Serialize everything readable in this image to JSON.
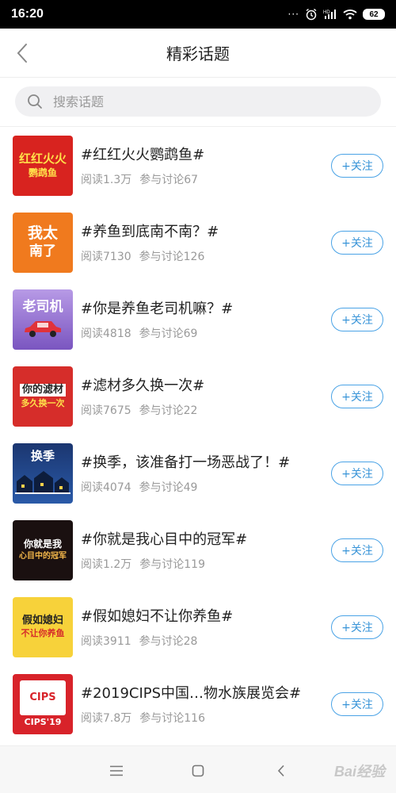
{
  "status_bar": {
    "time": "16:20",
    "signal_label": "HD",
    "battery": "62"
  },
  "header": {
    "title": "精彩话题"
  },
  "search": {
    "placeholder": "搜索话题"
  },
  "topics": [
    {
      "title": "#红红火火鹦鹉鱼#",
      "reads": "阅读1.3万",
      "discussions": "参与讨论67",
      "follow": "+关注",
      "thumb_line1": "红红火火",
      "thumb_line2": "鹦鹉鱼",
      "thumb_color": "#d8231f"
    },
    {
      "title": "#养鱼到底南不南？#",
      "reads": "阅读7130",
      "discussions": "参与讨论126",
      "follow": "+关注",
      "thumb_line1": "我太",
      "thumb_line2": "南了",
      "thumb_color": "#f07a1e"
    },
    {
      "title": "#你是养鱼老司机嘛？#",
      "reads": "阅读4818",
      "discussions": "参与讨论69",
      "follow": "+关注",
      "thumb_line1": "老司机",
      "thumb_line2": "",
      "thumb_color": "#8a63c9"
    },
    {
      "title": "#滤材多久换一次#",
      "reads": "阅读7675",
      "discussions": "参与讨论22",
      "follow": "+关注",
      "thumb_line1": "你的滤材",
      "thumb_line2": "多久换一次",
      "thumb_color": "#d62d2a"
    },
    {
      "title": "#换季，该准备打一场恶战了！#",
      "reads": "阅读4074",
      "discussions": "参与讨论49",
      "follow": "+关注",
      "thumb_line1": "换季",
      "thumb_line2": "",
      "thumb_color": "#1f3f7a"
    },
    {
      "title": "#你就是我心目中的冠军#",
      "reads": "阅读1.2万",
      "discussions": "参与讨论119",
      "follow": "+关注",
      "thumb_line1": "你就是我",
      "thumb_line2": "心目中的冠军",
      "thumb_color": "#1a1010"
    },
    {
      "title": "#假如媳妇不让你养鱼#",
      "reads": "阅读3911",
      "discussions": "参与讨论28",
      "follow": "+关注",
      "thumb_line1": "假如媳妇",
      "thumb_line2": "不让你养鱼",
      "thumb_color": "#f7d23a"
    },
    {
      "title": "#2019CIPS中国…物水族展览会#",
      "reads": "阅读7.8万",
      "discussions": "参与讨论116",
      "follow": "+关注",
      "thumb_line1": "CIPS",
      "thumb_line2": "CIPS'19",
      "thumb_color": "#d8232a"
    }
  ],
  "watermark": "Bai经验"
}
